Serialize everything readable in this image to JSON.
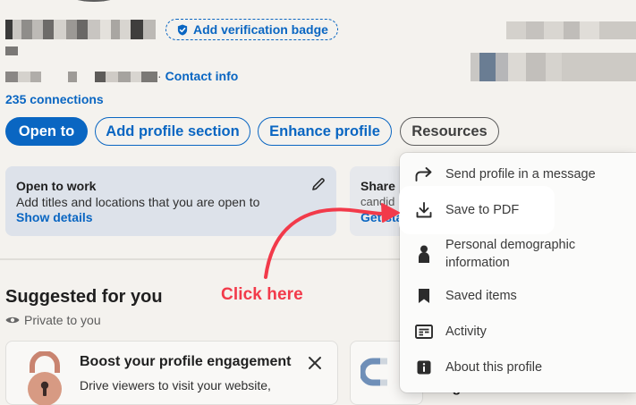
{
  "profile": {
    "verify_label": "Add verification badge",
    "contact_dot": "·",
    "contact_label": "Contact info",
    "connections": "235 connections"
  },
  "actions": {
    "open_to": "Open to",
    "add_section": "Add profile section",
    "enhance": "Enhance profile",
    "resources": "Resources"
  },
  "open_to_work": {
    "title": "Open to work",
    "description": "Add titles and locations that you are open to",
    "link": "Show details"
  },
  "share_card": {
    "title": "Share",
    "subtitle": "candid",
    "link": "Get sta"
  },
  "suggested": {
    "title": "Suggested for you",
    "private": "Private to you",
    "boost_title": "Boost your profile engagement",
    "boost_desc": "Drive viewers to visit your website,",
    "goals_text": "career goals"
  },
  "resources_menu": {
    "items": [
      {
        "label": "Send profile in a message",
        "icon": "share-arrow-icon"
      },
      {
        "label": "Save to PDF",
        "icon": "download-icon"
      },
      {
        "label": "Personal demographic information",
        "icon": "person-icon"
      },
      {
        "label": "Saved items",
        "icon": "bookmark-icon"
      },
      {
        "label": "Activity",
        "icon": "activity-icon"
      },
      {
        "label": "About this profile",
        "icon": "info-icon"
      }
    ]
  },
  "annotation": {
    "text": "Click here",
    "color": "#f23a4a"
  },
  "colors": {
    "brand_blue": "#0a66c2",
    "background": "#f4f2ee"
  }
}
